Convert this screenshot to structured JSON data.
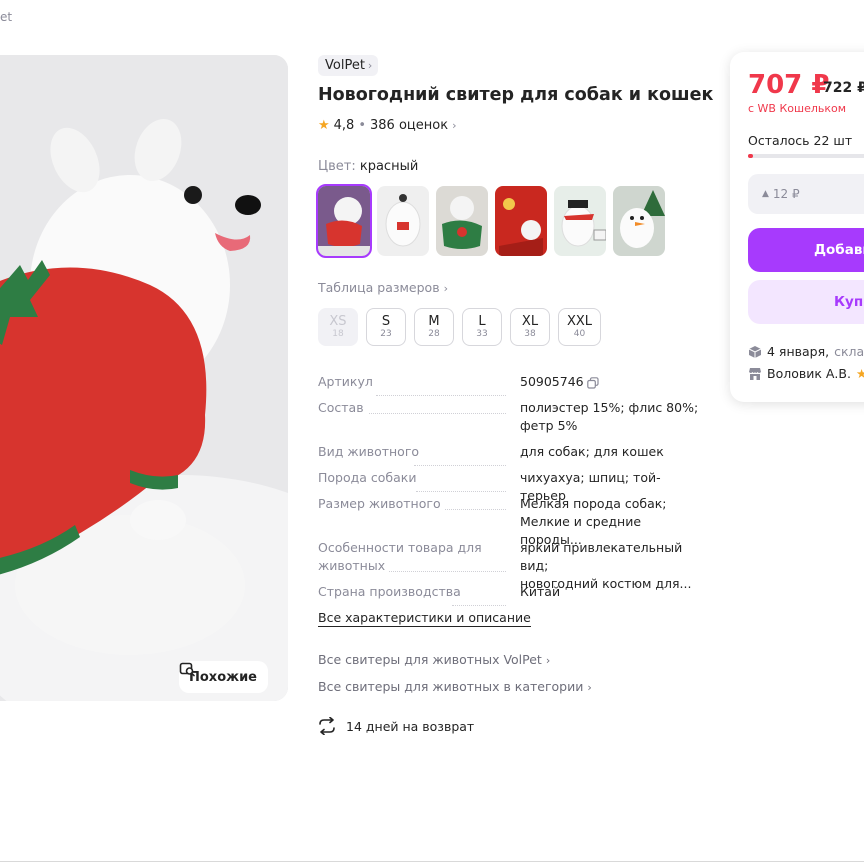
{
  "breadcrumb_fragment": "et",
  "product": {
    "brand": "VolPet",
    "title": "Новогодний свитер для собак и кошек",
    "rating": "4,8",
    "reviews": "386 оценок",
    "similar_label": "Похожие"
  },
  "color": {
    "label": "Цвет:",
    "value": "красный"
  },
  "size_table_label": "Таблица размеров",
  "sizes": [
    {
      "name": "XS",
      "ru": "18",
      "available": false
    },
    {
      "name": "S",
      "ru": "23",
      "available": true
    },
    {
      "name": "M",
      "ru": "28",
      "available": true
    },
    {
      "name": "L",
      "ru": "33",
      "available": true
    },
    {
      "name": "XL",
      "ru": "38",
      "available": true
    },
    {
      "name": "XXL",
      "ru": "40",
      "available": true
    }
  ],
  "specs": [
    {
      "key": "Артикул",
      "value": "50905746"
    },
    {
      "key": "Состав",
      "value": "полиэстер 15%; флис 80%;",
      "value2": "фетр 5%"
    },
    {
      "key": "Вид животного",
      "value": "для собак; для кошек"
    },
    {
      "key": "Порода собаки",
      "value": "чихуахуа; шпиц; той-терьер"
    },
    {
      "key": "Размер животного",
      "value": "Мелкая порода собак;",
      "value2": "Мелкие и средние породы..."
    },
    {
      "key": "Особенности товара для",
      "key2": "животных",
      "value": "яркий привлекательный вид;",
      "value2": "новогодний костюм для..."
    },
    {
      "key": "Страна производства",
      "value": "Китай"
    }
  ],
  "links": {
    "all_specs": "Все характеристики и описание",
    "brand_sweaters": "Все свитеры для животных VolPet",
    "category_sweaters": "Все свитеры для животных в категории"
  },
  "returns_label": "14 дней на возврат",
  "buy": {
    "price": "707 ₽",
    "old_price": "722 ₽",
    "wallet_note": "с WB Кошельком",
    "stock": "Осталось 22 шт",
    "stock_fraction": 0.03,
    "discount": "12 ₽",
    "add_to_cart": "Добави",
    "buy_now": "Купи",
    "delivery_date": "4 января,",
    "delivery_source": "склад",
    "seller": "Воловик А.В."
  },
  "colors": {
    "accent": "#a73afd",
    "price_red": "#f0384b",
    "star": "#f5a623"
  }
}
